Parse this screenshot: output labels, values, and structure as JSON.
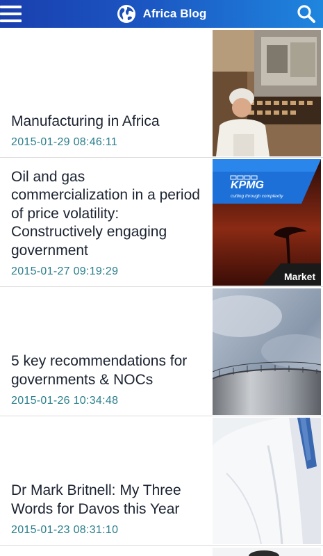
{
  "app": {
    "title": "Africa Blog"
  },
  "icons": {
    "menu": "hamburger-menu-icon",
    "globe": "globe-icon",
    "search": "search-icon"
  },
  "colors": {
    "header_start": "#1a3fae",
    "header_end": "#1f86de",
    "date_text": "#2b7f8c",
    "title_text": "#1b2230"
  },
  "articles": [
    {
      "title": "Manufacturing in Africa",
      "date": "2015-01-29 08:46:11",
      "thumbnail": "factory-worker-image"
    },
    {
      "title": "Oil and gas commercialization in a period of price volatility: Constructively engaging government",
      "date": "2015-01-27 09:19:29",
      "thumbnail": "kpmg-market-image",
      "thumb_brand": "KPMG",
      "thumb_tagline": "cutting through complexity",
      "thumb_label": "Market"
    },
    {
      "title": "5 key recommendations for governments & NOCs",
      "date": "2015-01-26 10:34:48",
      "thumbnail": "oil-storage-tank-image"
    },
    {
      "title": "Dr Mark Britnell: My Three Words for Davos this Year",
      "date": "2015-01-23 08:31:10",
      "thumbnail": "doctor-coat-image"
    }
  ]
}
